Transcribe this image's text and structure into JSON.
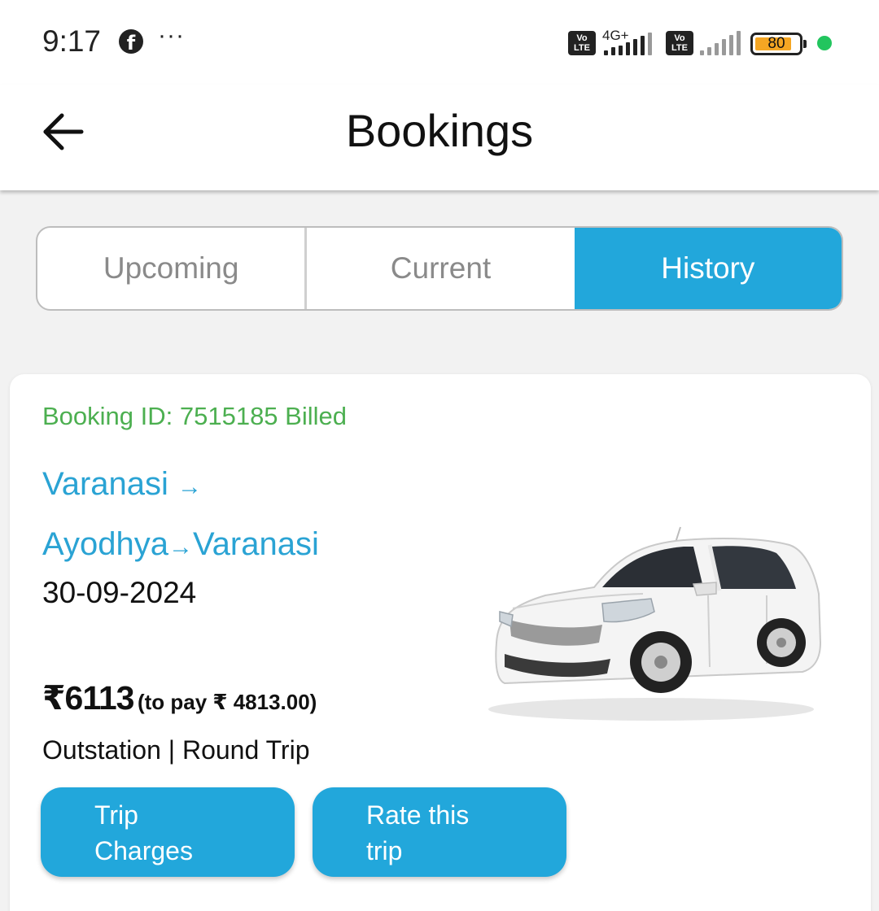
{
  "status_bar": {
    "time": "9:17",
    "app_icon": "facebook-icon",
    "more": "···",
    "volte_label": "Vo LTE",
    "network": "4G+",
    "battery": "80",
    "battery_color": "#f5a623",
    "indicator_color": "#22c55e"
  },
  "header": {
    "back_icon": "back-arrow-icon",
    "title": "Bookings"
  },
  "tabs": [
    {
      "label": "Upcoming",
      "active": false
    },
    {
      "label": "Current",
      "active": false
    },
    {
      "label": "History",
      "active": true
    }
  ],
  "booking": {
    "id_status": "Booking ID: 7515185 Billed",
    "route": {
      "from": "Varanasi",
      "via": "Ayodhya",
      "to": "Varanasi",
      "arrow": "→"
    },
    "date": "30-09-2024",
    "price": "₹6113",
    "to_pay": "(to pay ₹ 4813.00)",
    "trip_type": "Outstation | Round Trip",
    "car_image": "white-sedan-car",
    "buttons": {
      "trip_charges_line1": "Trip",
      "trip_charges_line2": "Charges",
      "rate_line1": "Rate this",
      "rate_line2": "trip"
    }
  },
  "colors": {
    "accent": "#22a7db",
    "route_text": "#2aa3d4",
    "status_green": "#4caf50",
    "inactive_tab_text": "#8a8a8a"
  }
}
